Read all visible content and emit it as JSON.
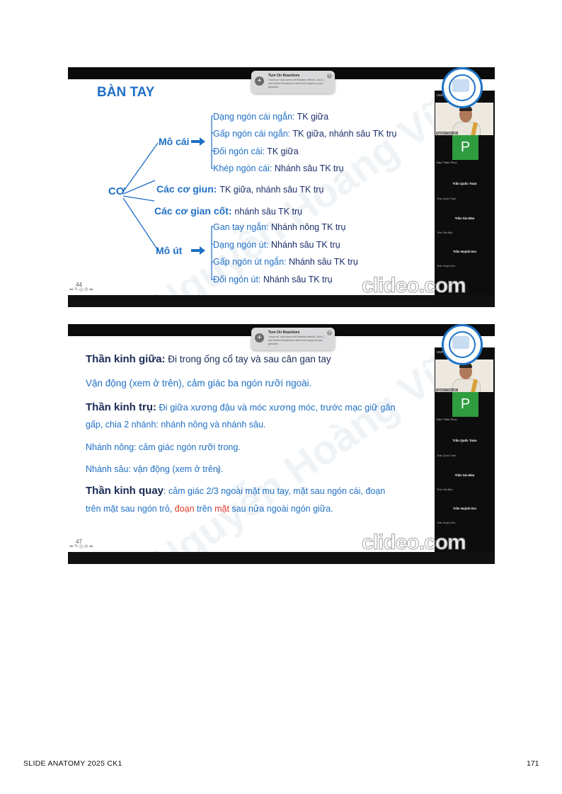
{
  "popup": {
    "title": "Turn On Reactions",
    "body": "\"zoom.us\" has turned off Reaction effects. Click ▢ and select Reactions to add more impact to your gestures."
  },
  "clideo": "clideo.com",
  "watermark": "Nguyễn Hoàng Vũ",
  "participants": {
    "ump": "UMP Cli",
    "cam_label": "Nguyen Toan gfb",
    "p_letter": "P",
    "p_sub": "Đào Thiện Phúc",
    "names": [
      {
        "name": "Trần Quốc Toàn",
        "sub": "Trần Quốc Toàn"
      },
      {
        "name": "Trần Gia Bảo",
        "sub": "Trần Gia Bảo"
      },
      {
        "name": "Trần Huỳnh Em",
        "sub": "Trần Huỳnh Em"
      }
    ]
  },
  "slide1": {
    "number": "44",
    "title": "BÀN TAY",
    "co": "CƠ",
    "mo_cai": "Mô cái",
    "mo_ut": "Mô út",
    "mo_cai_items": [
      {
        "a": "Dạng ngón cái ngắn: ",
        "b": "TK giữa"
      },
      {
        "a": "Gấp ngón cái ngắn: ",
        "b": "TK giữa, nhánh sâu TK trụ"
      },
      {
        "a": "Đối ngón cái: ",
        "b": "TK giữa"
      },
      {
        "a": "Khép ngón cái: ",
        "b": "Nhánh sâu TK trụ"
      }
    ],
    "giun": {
      "a": "Các cơ giun: ",
      "b": "TK giữa, nhánh sâu TK trụ"
    },
    "gian_cot": {
      "a": "Các cơ gian cốt: ",
      "b": "nhánh sâu TK trụ"
    },
    "mo_ut_items": [
      {
        "a": "Gan tay ngắn:  ",
        "b": "Nhánh nông TK trụ"
      },
      {
        "a": "Dạng ngón út: ",
        "b": "Nhánh sâu TK trụ"
      },
      {
        "a": "Gấp ngón út ngắn: ",
        "b": "Nhánh sâu TK trụ"
      },
      {
        "a": "Đối ngón út: ",
        "b": "Nhánh sâu TK trụ"
      }
    ]
  },
  "slide2": {
    "number": "47",
    "giua_head": "Thần kinh giữa:",
    "giua_text": " Đi trong ống cổ tay và sau cân gan tay",
    "giua_line2": "Vận động (xem ở trên), cảm giác ba ngón rưỡi ngoài.",
    "tru_head": "Thần kinh trụ:",
    "tru_text": " Đi giữa xương đậu và móc xương móc, trước mạc giữ gân",
    "tru_line2": "gấp, chia 2 nhánh: nhánh nông và nhánh sâu.",
    "nong": "Nhánh nông: cảm giác ngón rưỡi trong.",
    "sau": "Nhánh sâu: vận động (xem ở trên).",
    "quay_head": "Thần kinh quay",
    "quay_text": ": cảm giác 2/3 ngoài mặt mu tay, mặt sau ngón cái, đoạn",
    "quay_l2_a": "trên mặt sau ngón trỏ, ",
    "quay_l2_red1": "đoạn",
    "quay_l2_b": " trên ",
    "quay_l2_red2": "mặt",
    "quay_l2_c": " sau nửa ngoài ngón giữa."
  },
  "footer": {
    "left": "SLIDE ANATOMY 2025 CK1",
    "page": "171"
  },
  "colors": {
    "blue": "#1f6fc5",
    "navy": "#1a2a55",
    "red": "#e0392b",
    "green": "#2e9c3f"
  }
}
